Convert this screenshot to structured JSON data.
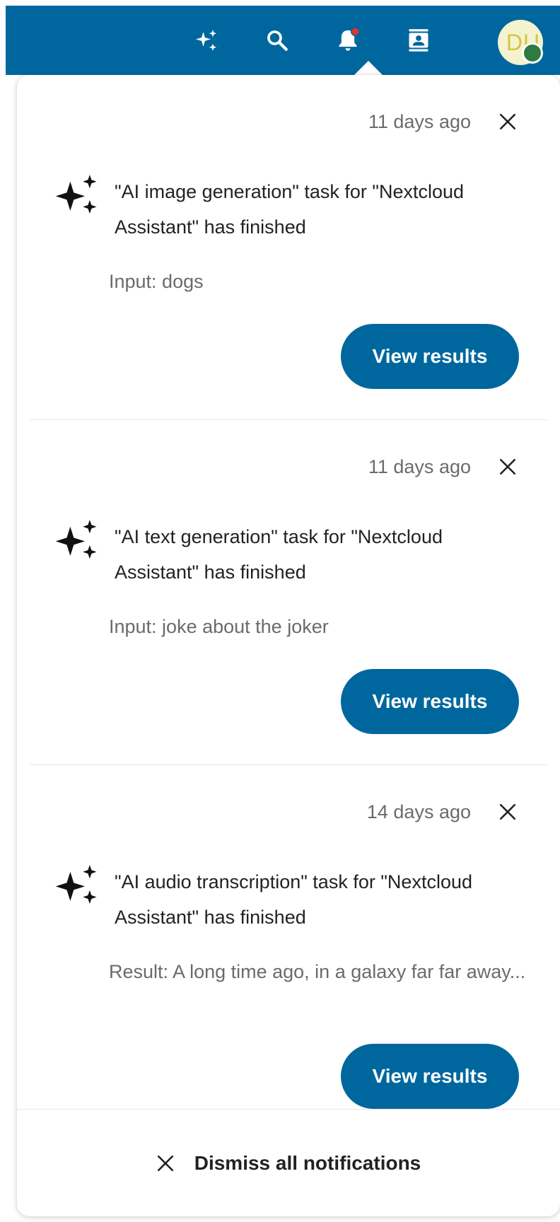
{
  "header": {
    "icons": [
      {
        "name": "assistant-icon",
        "symbol": "sparkles"
      },
      {
        "name": "search-icon",
        "symbol": "magnifier"
      },
      {
        "name": "notifications-icon",
        "symbol": "bell",
        "badge": true
      },
      {
        "name": "contacts-icon",
        "symbol": "contact-card"
      }
    ],
    "avatar_initials": "DU",
    "status": "online",
    "colors": {
      "bar": "#00679e",
      "badge": "#e9322d",
      "status_online": "#2d7b3f",
      "avatar_bg": "#f4f3cf"
    }
  },
  "notifications": [
    {
      "timestamp": "11 days ago",
      "title": "\"AI image generation\" task for \"Nextcloud Assistant\" has finished",
      "detail": "Input: dogs",
      "action_label": "View results"
    },
    {
      "timestamp": "11 days ago",
      "title": "\"AI text generation\" task for \"Nextcloud Assistant\" has finished",
      "detail": "Input: joke about the joker",
      "action_label": "View results"
    },
    {
      "timestamp": "14 days ago",
      "title": "\"AI audio transcription\" task for \"Nextcloud Assistant\" has finished",
      "detail": "Result: A long time ago, in a galaxy far far away...",
      "action_label": "View results"
    }
  ],
  "footer": {
    "dismiss_all_label": "Dismiss all notifications"
  },
  "accent_color": "#00679e"
}
